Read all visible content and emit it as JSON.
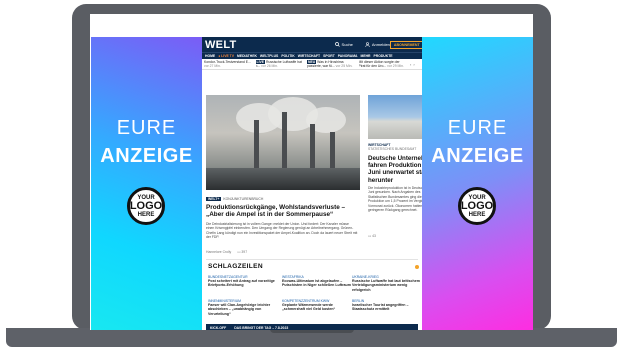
{
  "side_ads": {
    "eure": "EURE",
    "anzeige": "ANZEIGE",
    "logo_line1": "YOUR",
    "logo_line2": "LOGO",
    "logo_line3": "HERE"
  },
  "header": {
    "logo": "WELT",
    "search_label": "Suche",
    "login_label": "Anmelden",
    "subscribe_label": "ABONNEMENT"
  },
  "nav": {
    "items": [
      "HOME",
      "● LIVE TV",
      "MEDIATHEK",
      "WELTPLUS",
      "POLITIK",
      "WIRTSCHAFT",
      "SPORT",
      "PANORAMA",
      "MEHR",
      "PRODUKTE"
    ]
  },
  "ticker": [
    {
      "tag": "",
      "text": "Kondor-Truck-Testverstand E...",
      "time": "vor 27 Min."
    },
    {
      "tag": "LIVE",
      "text": "Russische Luftwaffe hat b...",
      "time": "vor 26 Min."
    },
    {
      "tag": "NEU",
      "text": "Was in Hiroshima passierte, war fü...",
      "time": "vor 25 Min."
    },
    {
      "tag": "",
      "text": "Mit dieser Aktion sorgte der Pirat für den Uro...",
      "time": "vor 29 Min."
    }
  ],
  "hero": {
    "badge": "WELT+",
    "kicker": "KONJUNKTURENBRUCH",
    "title": "Produktionsrückgänge, Wohlstandsverluste – „Aber die Ampel ist in der Sommerpause“",
    "teaser": "Die Deindustrialisierung ist in vollem Gange: meldet der Union. Und fordert: Der Kanzler müsse einen Krisengipfel einberufen. Den Umgang der Regierung genügt an Arbeitnehmergang. Grünen-Chefin Lang kündigt nun ein Investitionspaket der Ampel-Koalition an. Doch da lauert neuer Streit mit der FDP.",
    "author": "Hannelore Crolly",
    "comments": "397"
  },
  "side_story": {
    "kicker": "WIRTSCHAFT",
    "subkicker": "STATISTISCHES BUNDESAMT",
    "title": "Deutsche Unternehmen fahren Produktion im Juni unerwartet stark herunter",
    "teaser": "Die Industrieproduktion ist in Deutschland im Juni gesunken. Nach Angaben des Statistischen Bundesamtes ging die Produktion um 1,5 Prozent im Vergleich zum Vormonat zurück. Ökonomen hatten mit einem geringeren Rückgang gerechnet.",
    "comments": "43"
  },
  "schlagzeilen": {
    "title": "SCHLAGZEILEN",
    "items": [
      {
        "kicker": "BUNDESNETZAGENTUR",
        "text": "Post scheitert mit Antrag auf vorzeitige Briefporto-Erhöhung"
      },
      {
        "kicker": "WESTAFRIKA",
        "text": "Ecowas-Ultimatum ist abgelaufen – Putschisten in Niger schließen Luftraum"
      },
      {
        "kicker": "UKRAINE-KRIEG",
        "text": "Russische Luftwaffe hat laut britischem Verteidigungsministerium wenig erfolgreich"
      },
      {
        "kicker": "INNENMINISTERIUM",
        "text": "Faeser will Clan-Angehörige leichter abschieben – „unabhängig von Verurteilung“"
      },
      {
        "kicker": "KOMPETENZZENTRUM KWW",
        "text": "Geplante Wärmewende werde „schmerzhaft viel Geld kosten“"
      },
      {
        "kicker": "BERLIN",
        "text": "Israelischer Tourist angegriffen – Staatsschutz ermittelt"
      }
    ]
  },
  "footer_bar": {
    "left": "KICK-OFF",
    "right": "DAS BRINGT DER TAG – 7.8.2023"
  }
}
